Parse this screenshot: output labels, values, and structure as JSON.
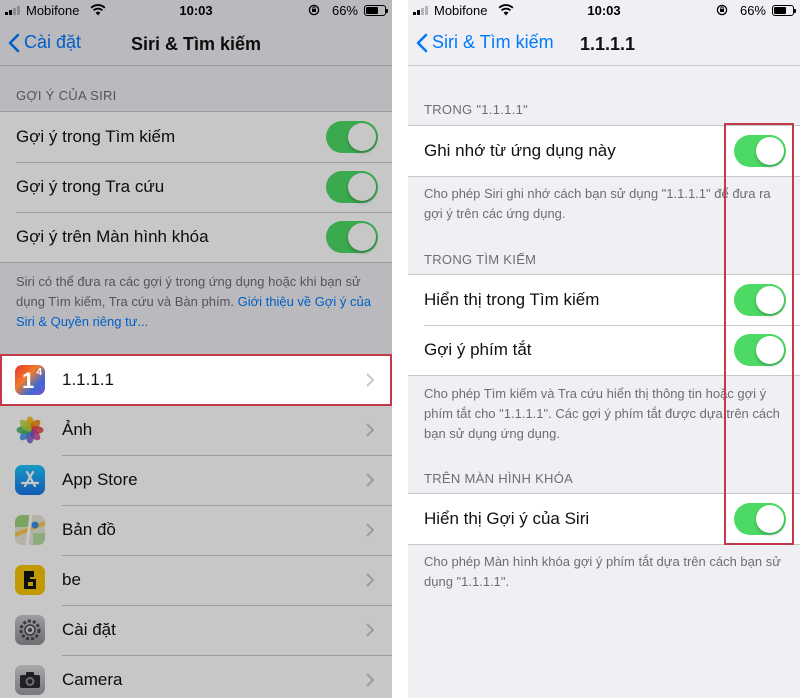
{
  "status": {
    "carrier": "Mobifone",
    "time": "10:03",
    "battery": "66%",
    "battery_level": 0.66
  },
  "left": {
    "back_label": "Cài đặt",
    "title": "Siri & Tìm kiếm",
    "section_header": "GỢI Ý CỦA SIRI",
    "rows": [
      {
        "label": "Gợi ý trong Tìm kiếm",
        "on": true
      },
      {
        "label": "Gợi ý trong Tra cứu",
        "on": true
      },
      {
        "label": "Gợi ý trên Màn hình khóa",
        "on": true
      }
    ],
    "footer_text": "Siri có thể đưa ra các gợi ý trong ứng dụng hoặc khi bạn sử dụng Tìm kiếm, Tra cứu và Bàn phím. ",
    "footer_link": "Giới thiệu về Gợi ý của Siri & Quyền riêng tư...",
    "apps": [
      {
        "label": "1.1.1.1",
        "icon": "cloudflare-1111-icon"
      },
      {
        "label": "Ảnh",
        "icon": "photos-icon"
      },
      {
        "label": "App Store",
        "icon": "app-store-icon"
      },
      {
        "label": "Bản đồ",
        "icon": "maps-icon"
      },
      {
        "label": "be",
        "icon": "be-icon"
      },
      {
        "label": "Cài đặt",
        "icon": "settings-gear-icon"
      },
      {
        "label": "Camera",
        "icon": "camera-icon"
      }
    ],
    "icon_badge": "4"
  },
  "right": {
    "back_label": "Siri & Tìm kiếm",
    "title": "1.1.1.1",
    "sections": [
      {
        "header": "TRONG \"1.1.1.1\"",
        "rows": [
          {
            "label": "Ghi nhớ từ ứng dụng này",
            "on": true
          }
        ],
        "footer": "Cho phép Siri ghi nhớ cách bạn sử dụng \"1.1.1.1\" để đưa ra gợi ý trên các ứng dụng."
      },
      {
        "header": "TRONG TÌM KIẾM",
        "rows": [
          {
            "label": "Hiển thị trong Tìm kiếm",
            "on": true
          },
          {
            "label": "Gợi ý phím tắt",
            "on": true
          }
        ],
        "footer": "Cho phép Tìm kiếm và Tra cứu hiển thị thông tin hoặc gợi ý phím tắt cho \"1.1.1.1\". Các gợi ý phím tắt được dựa trên cách bạn sử dụng ứng dụng."
      },
      {
        "header": "TRÊN MÀN HÌNH KHÓA",
        "rows": [
          {
            "label": "Hiển thị Gợi ý của Siri",
            "on": true
          }
        ],
        "footer": "Cho phép Màn hình khóa gợi ý phím tắt dựa trên cách bạn sử dụng \"1.1.1.1\"."
      }
    ]
  },
  "colors": {
    "accent": "#007aff",
    "toggle_on": "#4cd964",
    "highlight": "#c23a4a",
    "background": "#efeff4"
  }
}
